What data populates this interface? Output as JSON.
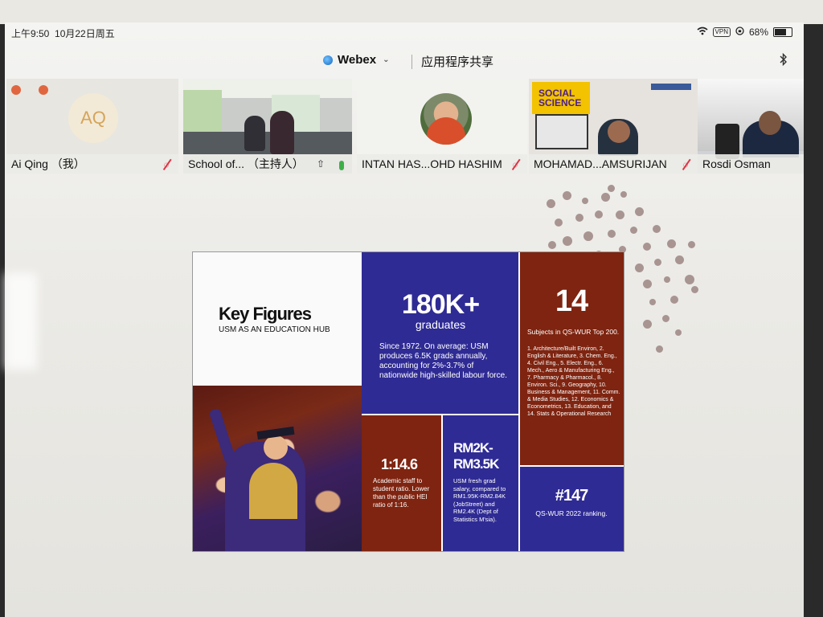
{
  "status_bar": {
    "time": "上午9:50",
    "date": "10月22日周五",
    "wifi_icon": "wifi-icon",
    "vpn_label": "VPN",
    "battery_percent": "68%",
    "battery_level": 0.68
  },
  "header": {
    "app_name": "Webex",
    "share_label": "应用程序共享",
    "bluetooth_icon": "bluetooth-icon"
  },
  "participants": [
    {
      "name": "Ai Qing （我）",
      "initials": "AQ",
      "muted": true
    },
    {
      "name": "School of... （主持人）",
      "muted": false
    },
    {
      "name": "INTAN HAS...OHD HASHIM",
      "muted": true
    },
    {
      "name": "MOHAMAD...AMSURIJAN",
      "muted": true,
      "book_text": "SOCIAL SCIENCE"
    },
    {
      "name": "Rosdi Osman",
      "muted": false
    }
  ],
  "slide": {
    "title": "Key Figures",
    "subtitle": "USM AS AN EDUCATION HUB",
    "graduates": {
      "value": "180K+",
      "label": "graduates",
      "text": "Since 1972. On average: USM produces 6.5K grads annually, accounting for 2%-3.7% of nationwide high-skilled labour force."
    },
    "subjects": {
      "value": "14",
      "label": "Subjects in QS-WUR Top 200.",
      "list": "1. Architecture/Built Environ, 2. English & Literature, 3. Chem. Eng., 4. Civil Eng., 5. Electr. Eng., 6. Mech., Aero & Manufacturing Eng., 7. Pharmacy & Pharmacol., 8. Environ. Sci., 9. Geography, 10. Business & Management, 11. Comm. & Media Studies, 12. Economics & Econometrics, 13. Education, and 14. Stats & Operational Research"
    },
    "ratio": {
      "value": "1:14.6",
      "text": "Academic staff to student ratio. Lower than the public HEI ratio of 1:16."
    },
    "salary": {
      "value": "RM2K-RM3.5K",
      "text": "USM fresh grad salary, compared to RM1.95K-RM2.84K (JobStreet) and RM2.4K (Dept of Statistics M'sia)."
    },
    "ranking": {
      "value": "#147",
      "label": "QS-WUR 2022 ranking."
    }
  },
  "colors": {
    "slide_blue": "#2f2b94",
    "slide_red": "#7e2410",
    "mute_red": "#d33344"
  }
}
